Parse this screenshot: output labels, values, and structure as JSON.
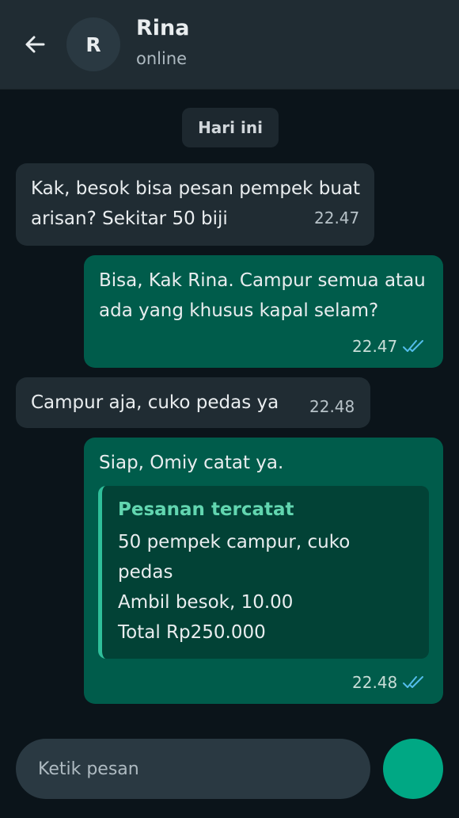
{
  "header": {
    "avatar_initial": "R",
    "contact_name": "Rina",
    "status": "online"
  },
  "chat": {
    "date_label": "Hari ini",
    "messages": [
      {
        "direction": "in",
        "text": "Kak, besok bisa pesan pempek buat arisan? Sekitar 50 biji",
        "time": "22.47"
      },
      {
        "direction": "out",
        "text": "Bisa, Kak Rina. Campur semua atau ada yang khusus kapal selam?",
        "time": "22.47",
        "read_icon": "double-check-icon"
      },
      {
        "direction": "in",
        "text": "Campur aja, cuko pedas ya",
        "time": "22.48"
      },
      {
        "direction": "out",
        "text": "Siap, Omiy catat ya.",
        "time": "22.48",
        "read_icon": "double-check-icon",
        "card": {
          "title": "Pesanan tercatat",
          "lines": [
            "50 pempek campur, cuko pedas",
            "Ambil besok, 10.00",
            "Total Rp250.000"
          ]
        }
      }
    ]
  },
  "composer": {
    "placeholder": "Ketik pesan"
  },
  "colors": {
    "background": "#0b141a",
    "header": "#202c33",
    "incoming_bubble": "#202c33",
    "outgoing_bubble": "#005c4b",
    "card": "#024236",
    "card_title": "#62d6b0",
    "read_tick": "#53bdeb",
    "send_button": "#00a884"
  }
}
